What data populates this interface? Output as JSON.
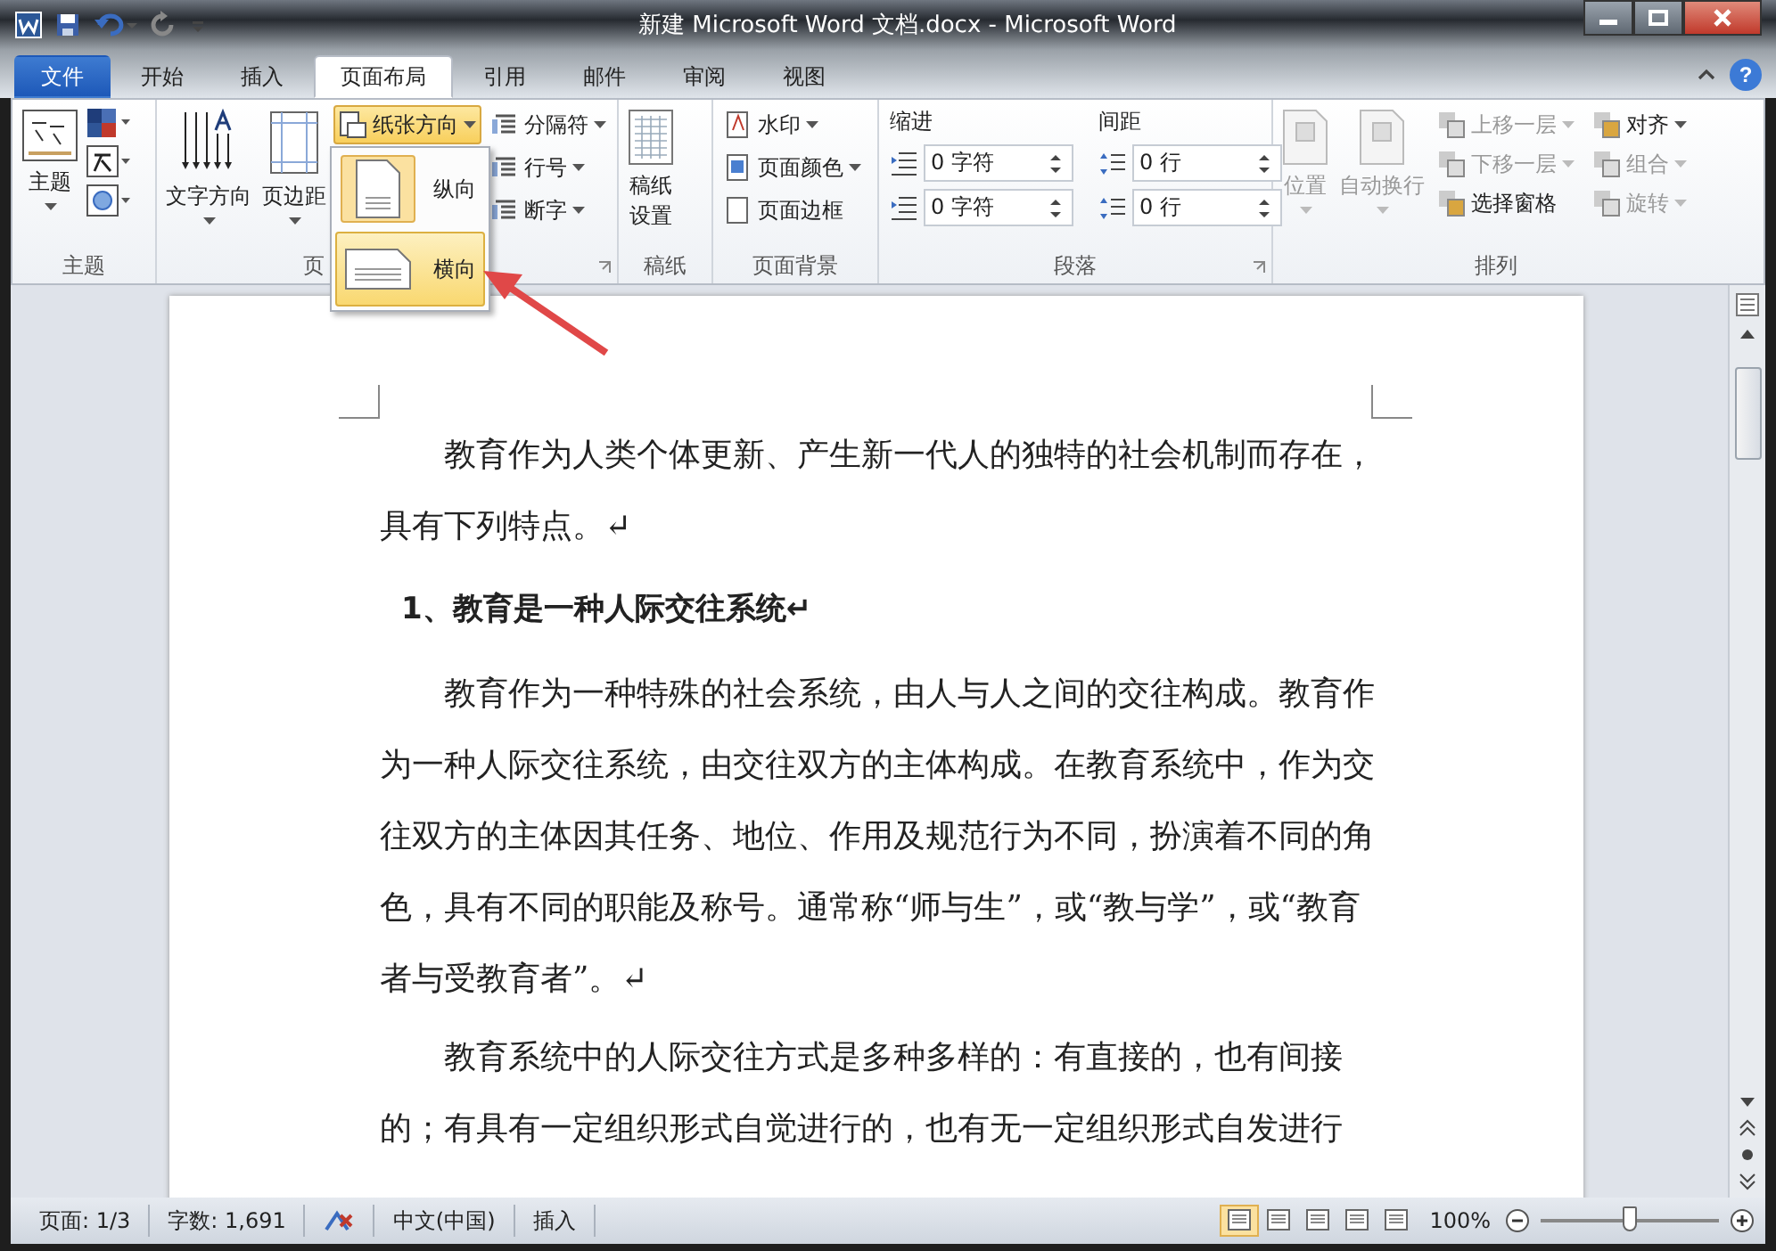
{
  "window": {
    "title": "新建 Microsoft Word 文档.docx - Microsoft Word"
  },
  "help": "?",
  "tabs": [
    {
      "label": "文件",
      "kind": "file",
      "selected": false
    },
    {
      "label": "开始",
      "kind": "tab",
      "selected": false
    },
    {
      "label": "插入",
      "kind": "tab",
      "selected": false
    },
    {
      "label": "页面布局",
      "kind": "tab",
      "selected": true
    },
    {
      "label": "引用",
      "kind": "tab",
      "selected": false
    },
    {
      "label": "邮件",
      "kind": "tab",
      "selected": false
    },
    {
      "label": "审阅",
      "kind": "tab",
      "selected": false
    },
    {
      "label": "视图",
      "kind": "tab",
      "selected": false
    }
  ],
  "ribbon": {
    "theme": {
      "label": "主题",
      "button": "主题"
    },
    "page_setup": {
      "label": "页",
      "large": [
        {
          "label": "文字方向"
        },
        {
          "label": "页边距"
        }
      ],
      "orientation": {
        "label": "纸张方向",
        "expanded": true
      },
      "small": [
        {
          "label": "分隔符"
        },
        {
          "label": "行号"
        },
        {
          "label": "断字"
        }
      ],
      "orientation_menu": [
        {
          "label": "纵向",
          "checked": true,
          "selected": false
        },
        {
          "label": "横向",
          "checked": false,
          "selected": true
        }
      ]
    },
    "draft": {
      "label": "稿纸",
      "button": "稿纸设置"
    },
    "background": {
      "label": "页面背景",
      "items": [
        {
          "label": "水印",
          "dropdown": true
        },
        {
          "label": "页面颜色",
          "dropdown": true
        },
        {
          "label": "页面边框",
          "dropdown": false
        }
      ]
    },
    "paragraph": {
      "label": "段落",
      "indent_label": "缩进",
      "indent": [
        "0 字符",
        "0 字符"
      ],
      "spacing_label": "间距",
      "spacing": [
        "0 行",
        "0 行"
      ]
    },
    "arrange": {
      "label": "排列",
      "large": [
        {
          "label": "位置",
          "disabled": true
        },
        {
          "label": "自动换行",
          "disabled": true
        }
      ],
      "small": [
        {
          "label": "上移一层",
          "disabled": true
        },
        {
          "label": "对齐",
          "disabled": false
        },
        {
          "label": "下移一层",
          "disabled": true
        },
        {
          "label": "组合",
          "disabled": true
        },
        {
          "label": "选择窗格",
          "disabled": false
        },
        {
          "label": "旋转",
          "disabled": true
        }
      ]
    }
  },
  "document": {
    "paragraphs": [
      {
        "kind": "body",
        "text": "教育作为人类个体更新、产生新一代人的独特的社会机制而存在，具有下列特点。↵"
      },
      {
        "kind": "heading",
        "text": "1、教育是一种人际交往系统↵"
      },
      {
        "kind": "body",
        "text": "教育作为一种特殊的社会系统，由人与人之间的交往构成。教育作为一种人际交往系统，由交往双方的主体构成。在教育系统中，作为交往双方的主体因其任务、地位、作用及规范行为不同，扮演着不同的角色，具有不同的职能及称号。通常称“师与生”，或“教与学”，或“教育者与受教育者”。↵"
      },
      {
        "kind": "body",
        "text": "教育系统中的人际交往方式是多种多样的：有直接的，也有间接的；有具有一定组织形式自觉进行的，也有无一定组织形式自发进行"
      }
    ]
  },
  "status_bar": {
    "page": "页面: 1/3",
    "words": "字数: 1,691",
    "language": "中文(中国)",
    "mode": "插入",
    "views": [
      {
        "selected": true
      },
      {
        "selected": false
      },
      {
        "selected": false
      },
      {
        "selected": false
      },
      {
        "selected": false
      }
    ],
    "zoom": "100%",
    "zoom_slider": {
      "level": 0.5
    }
  }
}
